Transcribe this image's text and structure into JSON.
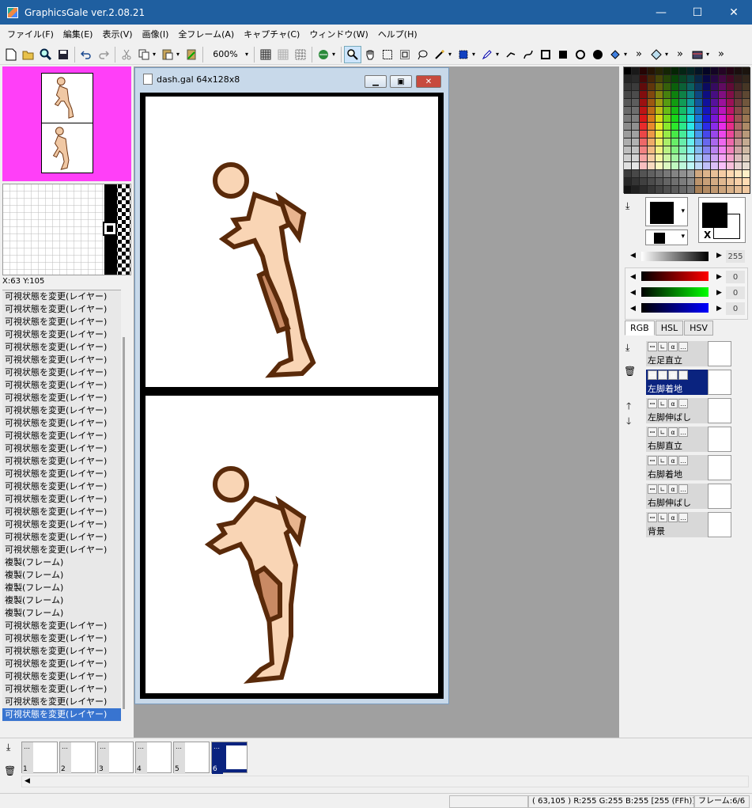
{
  "window": {
    "title": "GraphicsGale ver.2.08.21",
    "minimize": "—",
    "maximize": "☐",
    "close": "✕"
  },
  "menu": [
    "ファイル(F)",
    "編集(E)",
    "表示(V)",
    "画像(I)",
    "全フレーム(A)",
    "キャプチャ(C)",
    "ウィンドウ(W)",
    "ヘルプ(H)"
  ],
  "toolbar": {
    "zoom": "600%",
    "icons": [
      "new-file-icon",
      "open-folder-icon",
      "zoom-lens-icon",
      "save-icon",
      "undo-icon",
      "redo-icon",
      "cut-icon",
      "copy-icon",
      "paste-icon",
      "paste-special-icon"
    ],
    "more": "»"
  },
  "preview": {
    "coords": "X:63 Y:105"
  },
  "history": {
    "items": [
      "可視状態を変更(レイヤー)",
      "可視状態を変更(レイヤー)",
      "可視状態を変更(レイヤー)",
      "可視状態を変更(レイヤー)",
      "可視状態を変更(レイヤー)",
      "可視状態を変更(レイヤー)",
      "可視状態を変更(レイヤー)",
      "可視状態を変更(レイヤー)",
      "可視状態を変更(レイヤー)",
      "可視状態を変更(レイヤー)",
      "可視状態を変更(レイヤー)",
      "可視状態を変更(レイヤー)",
      "可視状態を変更(レイヤー)",
      "可視状態を変更(レイヤー)",
      "可視状態を変更(レイヤー)",
      "可視状態を変更(レイヤー)",
      "可視状態を変更(レイヤー)",
      "可視状態を変更(レイヤー)",
      "可視状態を変更(レイヤー)",
      "可視状態を変更(レイヤー)",
      "可視状態を変更(レイヤー)",
      "複製(フレーム)",
      "複製(フレーム)",
      "複製(フレーム)",
      "複製(フレーム)",
      "複製(フレーム)",
      "可視状態を変更(レイヤー)",
      "可視状態を変更(レイヤー)",
      "可視状態を変更(レイヤー)",
      "可視状態を変更(レイヤー)",
      "可視状態を変更(レイヤー)",
      "可視状態を変更(レイヤー)",
      "可視状態を変更(レイヤー)",
      "可視状態を変更(レイヤー)"
    ],
    "selected_index": 33
  },
  "document": {
    "title": "dash.gal 64x128x8",
    "min": "▁",
    "max": "▣",
    "close": "✕"
  },
  "colors": {
    "foreground": "#000000",
    "background": "#ffffff",
    "gray_value": "255",
    "r": "0",
    "g": "0",
    "b": "0",
    "swap_label": "X",
    "skin_light": "#f9d5b5",
    "skin_mid": "#e8b48e",
    "skin_dark": "#c98a64",
    "outline": "#5a2a0a"
  },
  "color_tabs": [
    "RGB",
    "HSL",
    "HSV"
  ],
  "layers": [
    {
      "name": "左足直立",
      "selected": false
    },
    {
      "name": "左脚着地",
      "selected": true
    },
    {
      "name": "左脚伸ばし",
      "selected": false
    },
    {
      "name": "右脚直立",
      "selected": false
    },
    {
      "name": "右脚着地",
      "selected": false
    },
    {
      "name": "右脚伸ばし",
      "selected": false
    },
    {
      "name": "背景",
      "selected": false
    }
  ],
  "frames": [
    {
      "num": "1",
      "selected": false
    },
    {
      "num": "2",
      "selected": false
    },
    {
      "num": "3",
      "selected": false
    },
    {
      "num": "4",
      "selected": false
    },
    {
      "num": "5",
      "selected": false
    },
    {
      "num": "6",
      "selected": true
    }
  ],
  "status": {
    "pixel": "( 63,105 ) R:255 G:255 B:255  [255 (FFh)]",
    "frame": "フレーム:6/6"
  }
}
